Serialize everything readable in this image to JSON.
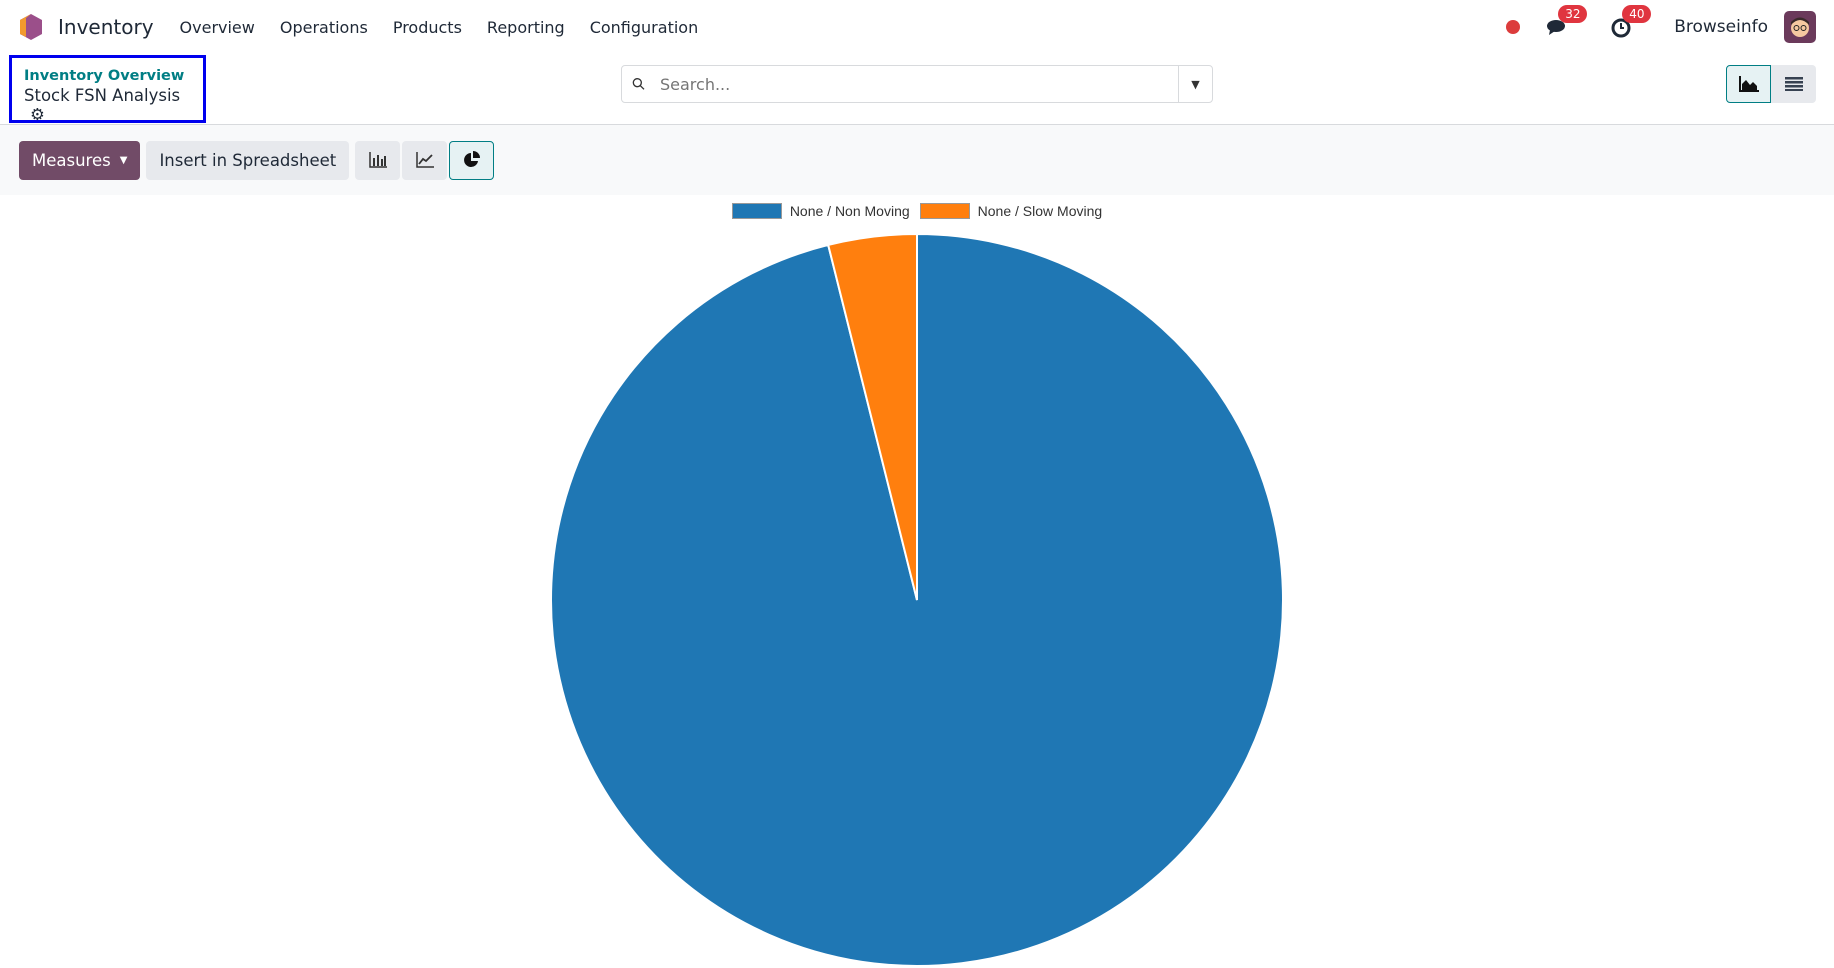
{
  "nav": {
    "app": "Inventory",
    "menu": [
      "Overview",
      "Operations",
      "Products",
      "Reporting",
      "Configuration"
    ],
    "messages_count": "32",
    "activities_count": "40",
    "user": "Browseinfo"
  },
  "breadcrumb": {
    "parent": "Inventory Overview",
    "current": "Stock FSN Analysis"
  },
  "search": {
    "placeholder": "Search..."
  },
  "toolbar": {
    "measures": "Measures",
    "insert": "Insert in Spreadsheet"
  },
  "chart_data": {
    "type": "pie",
    "legend_placement": "top",
    "labels": [
      "None / Non Moving",
      "None / Slow Moving"
    ],
    "values": [
      96.1,
      3.9
    ],
    "colors": [
      "#1f77b4",
      "#ff7f0e"
    ]
  }
}
